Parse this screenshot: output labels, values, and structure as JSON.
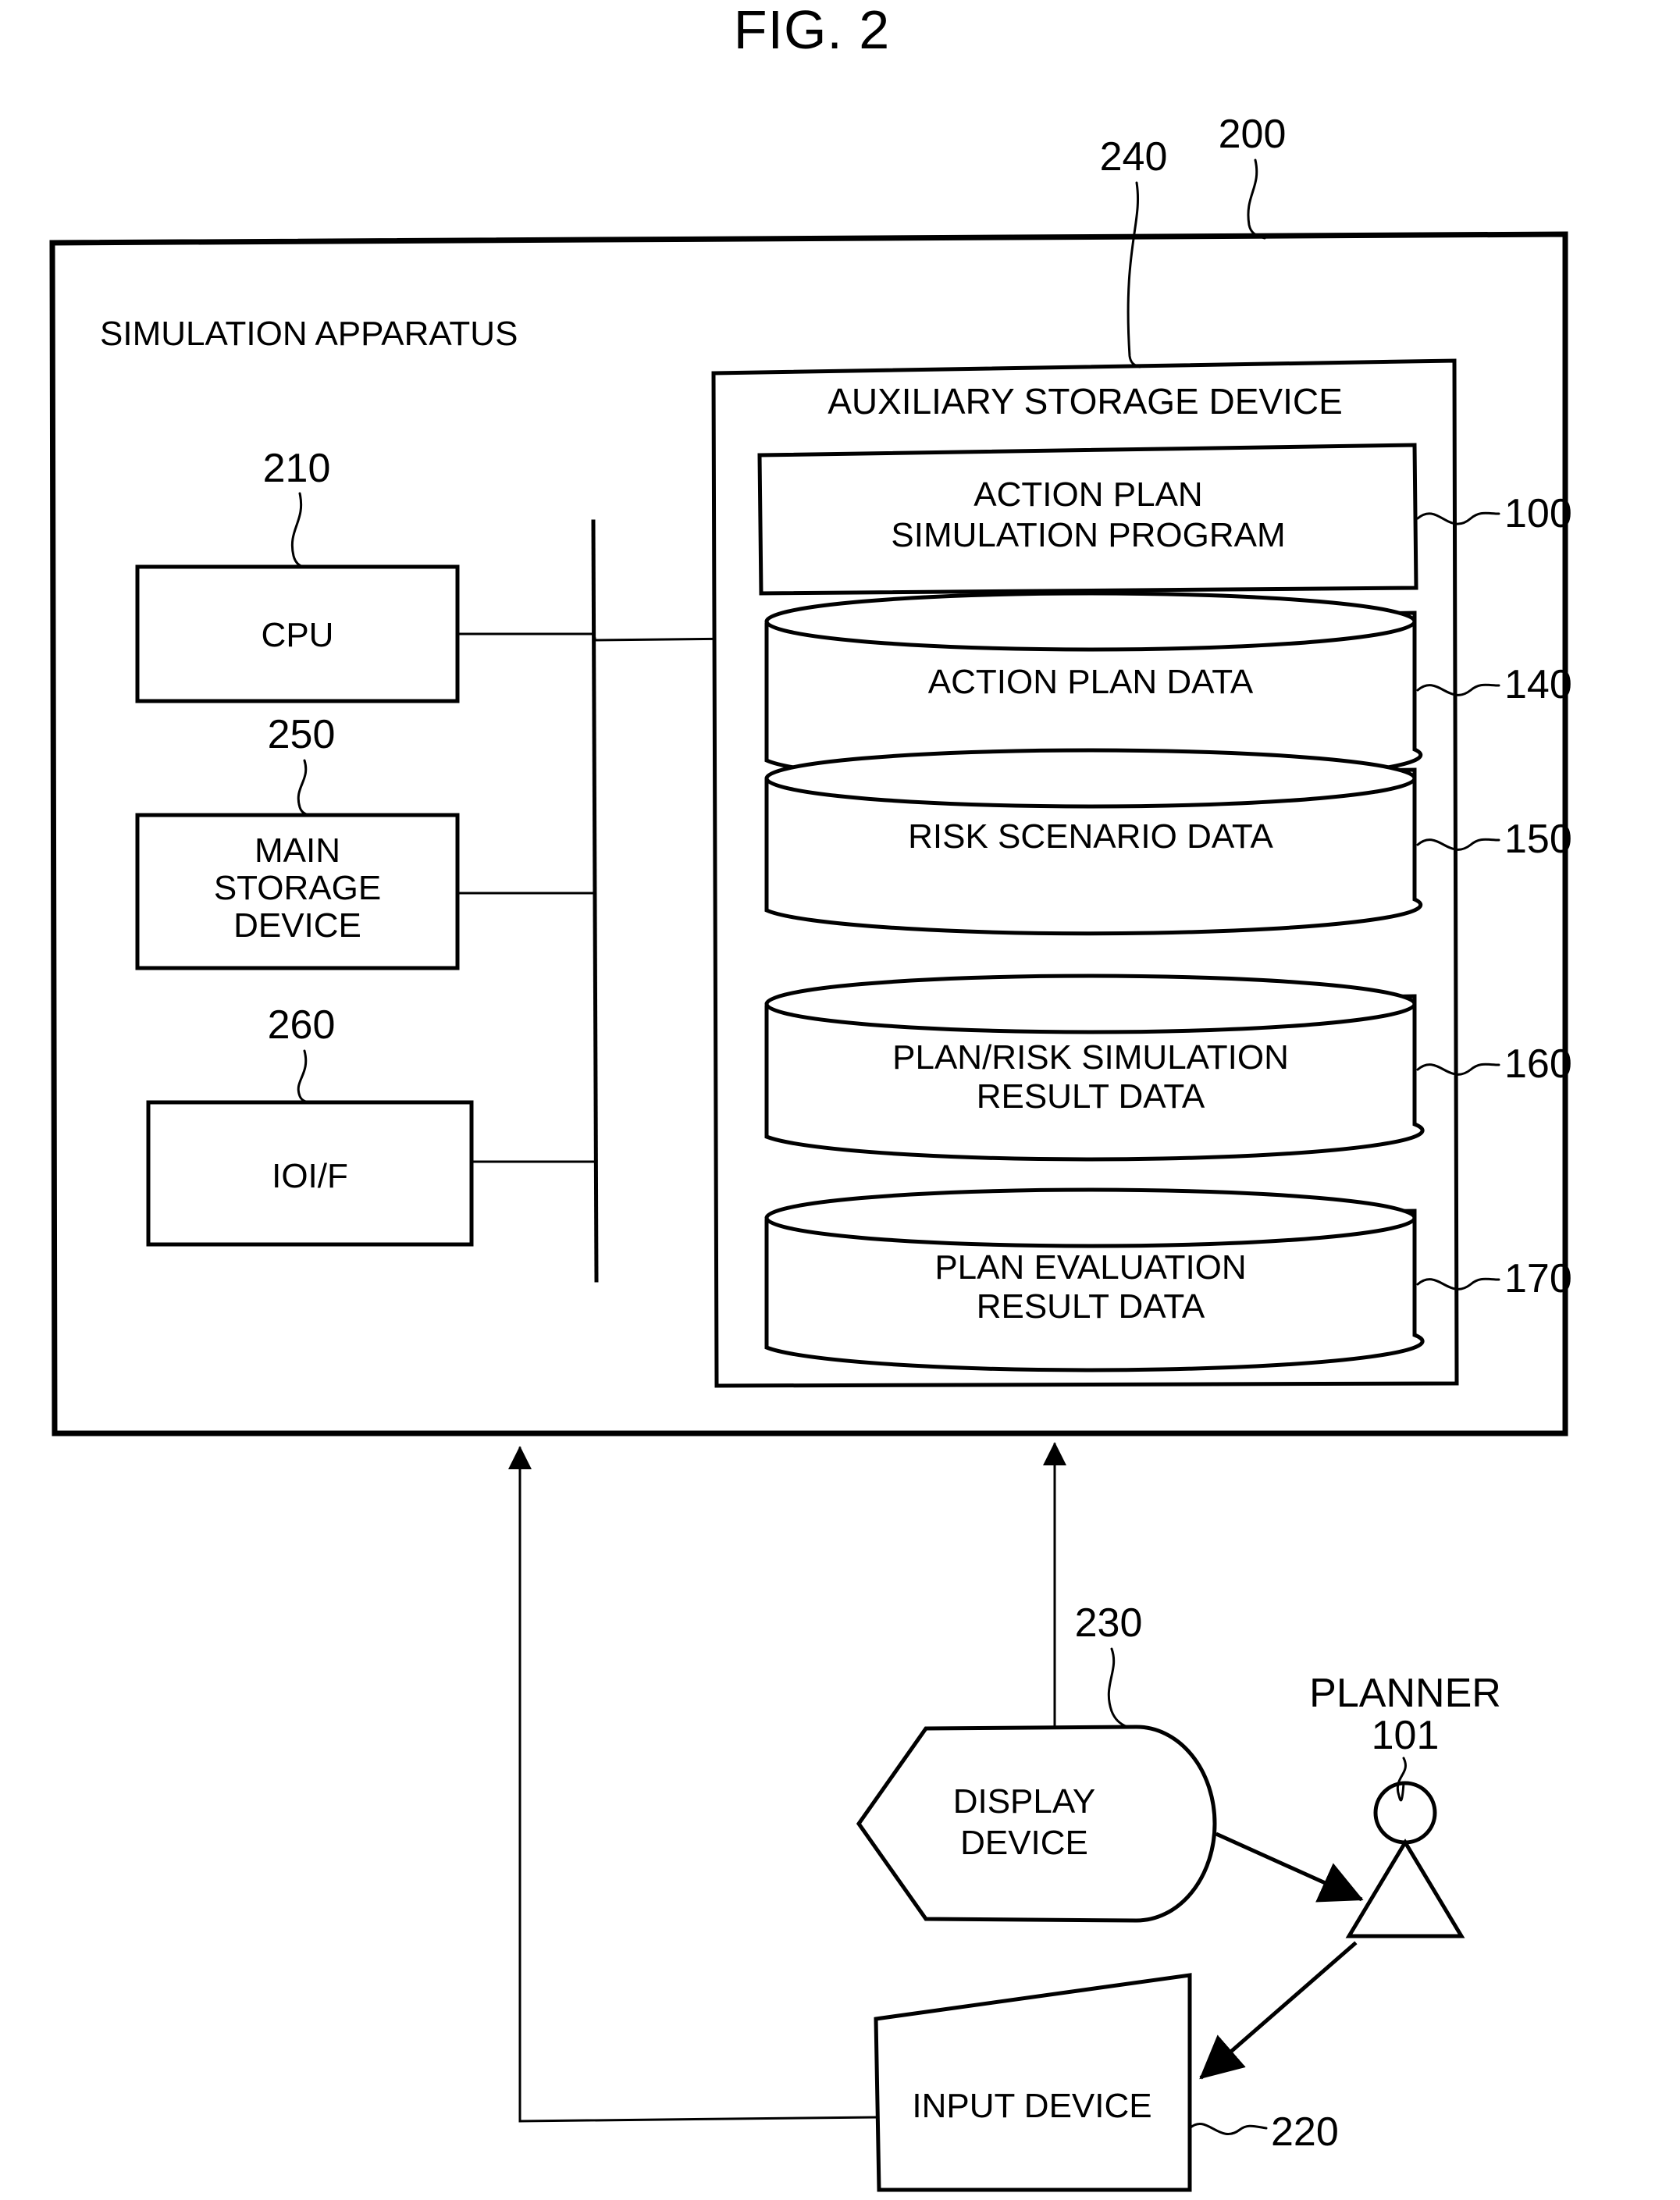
{
  "figure": {
    "title": "FIG. 2",
    "type": "patent-block-diagram"
  },
  "apparatus": {
    "label": "SIMULATION APPARATUS",
    "ref": "200"
  },
  "components": [
    {
      "id": "cpu",
      "label": "CPU",
      "ref": "210"
    },
    {
      "id": "main-storage",
      "label": "MAIN\nSTORAGE\nDEVICE",
      "line1": "MAIN",
      "line2": "STORAGE",
      "line3": "DEVICE",
      "ref": "250"
    },
    {
      "id": "io-interface",
      "label": "IOI/F",
      "ref": "260"
    }
  ],
  "auxiliary_storage": {
    "label": "AUXILIARY STORAGE DEVICE",
    "ref": "240",
    "items": [
      {
        "id": "action-plan-simulation-program",
        "shape": "rect",
        "line1": "ACTION PLAN",
        "line2": "SIMULATION PROGRAM",
        "ref": "100"
      },
      {
        "id": "action-plan-data",
        "shape": "cylinder",
        "line1": "ACTION PLAN DATA",
        "line2": "",
        "ref": "140"
      },
      {
        "id": "risk-scenario-data",
        "shape": "cylinder",
        "line1": "RISK SCENARIO DATA",
        "line2": "",
        "ref": "150"
      },
      {
        "id": "plan-risk-simulation-result-data",
        "shape": "cylinder",
        "line1": "PLAN/RISK SIMULATION",
        "line2": "RESULT DATA",
        "ref": "160"
      },
      {
        "id": "plan-evaluation-result-data",
        "shape": "cylinder",
        "line1": "PLAN EVALUATION",
        "line2": "RESULT DATA",
        "ref": "170"
      }
    ]
  },
  "peripherals": [
    {
      "id": "display-device",
      "line1": "DISPLAY",
      "line2": "DEVICE",
      "ref": "230"
    },
    {
      "id": "input-device",
      "line1": "INPUT DEVICE",
      "line2": "",
      "ref": "220"
    }
  ],
  "actor": {
    "label": "PLANNER",
    "ref": "101"
  },
  "colors": {
    "ink": "#000000",
    "paper": "#ffffff"
  }
}
